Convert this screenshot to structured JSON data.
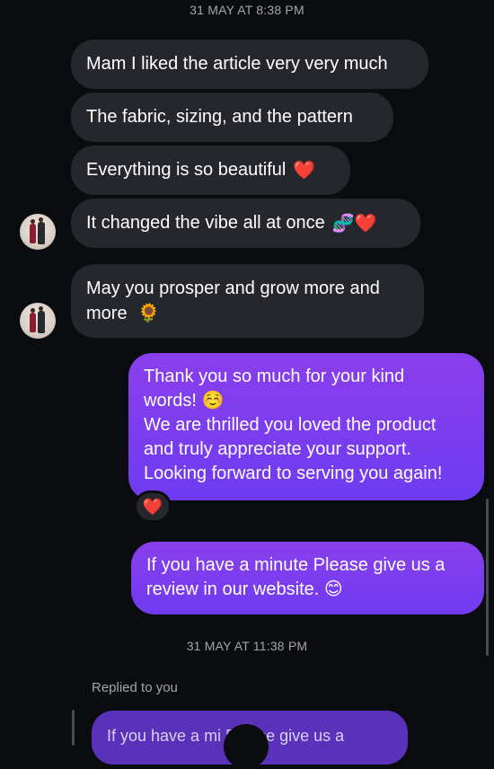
{
  "thread": {
    "timestamp_1": "31 MAY AT 8:38 PM",
    "timestamp_2": "31 MAY AT 11:38 PM"
  },
  "incoming": [
    {
      "text": "Mam I liked the article very very much"
    },
    {
      "text": "The fabric, sizing, and the pattern"
    },
    {
      "text": "Everything is so beautiful",
      "emoji": "❤️"
    },
    {
      "text": "It changed the vibe all at once",
      "emoji": "🧬❤️"
    },
    {
      "line1": "May you prosper and grow more and",
      "line2": "more",
      "emoji": "🌻"
    }
  ],
  "outgoing": [
    {
      "lines": [
        "Thank you so much for your kind",
        "words! ☺️",
        "We are thrilled you loved the product",
        "and truly appreciate your support.",
        "Looking forward to serving you again!"
      ],
      "reaction": "❤️"
    },
    {
      "lines": [
        "If you have a minute Please give us a",
        "review in our website. 😊"
      ]
    }
  ],
  "reply": {
    "label": "Replied to you",
    "quoted_text": "If you have a mi      Please give us a"
  },
  "colors": {
    "background": "#0b0c10",
    "incoming_bubble": "#26272c",
    "outgoing_bubble": "#7a3cee",
    "timestamp_text": "#a5a6ab"
  }
}
